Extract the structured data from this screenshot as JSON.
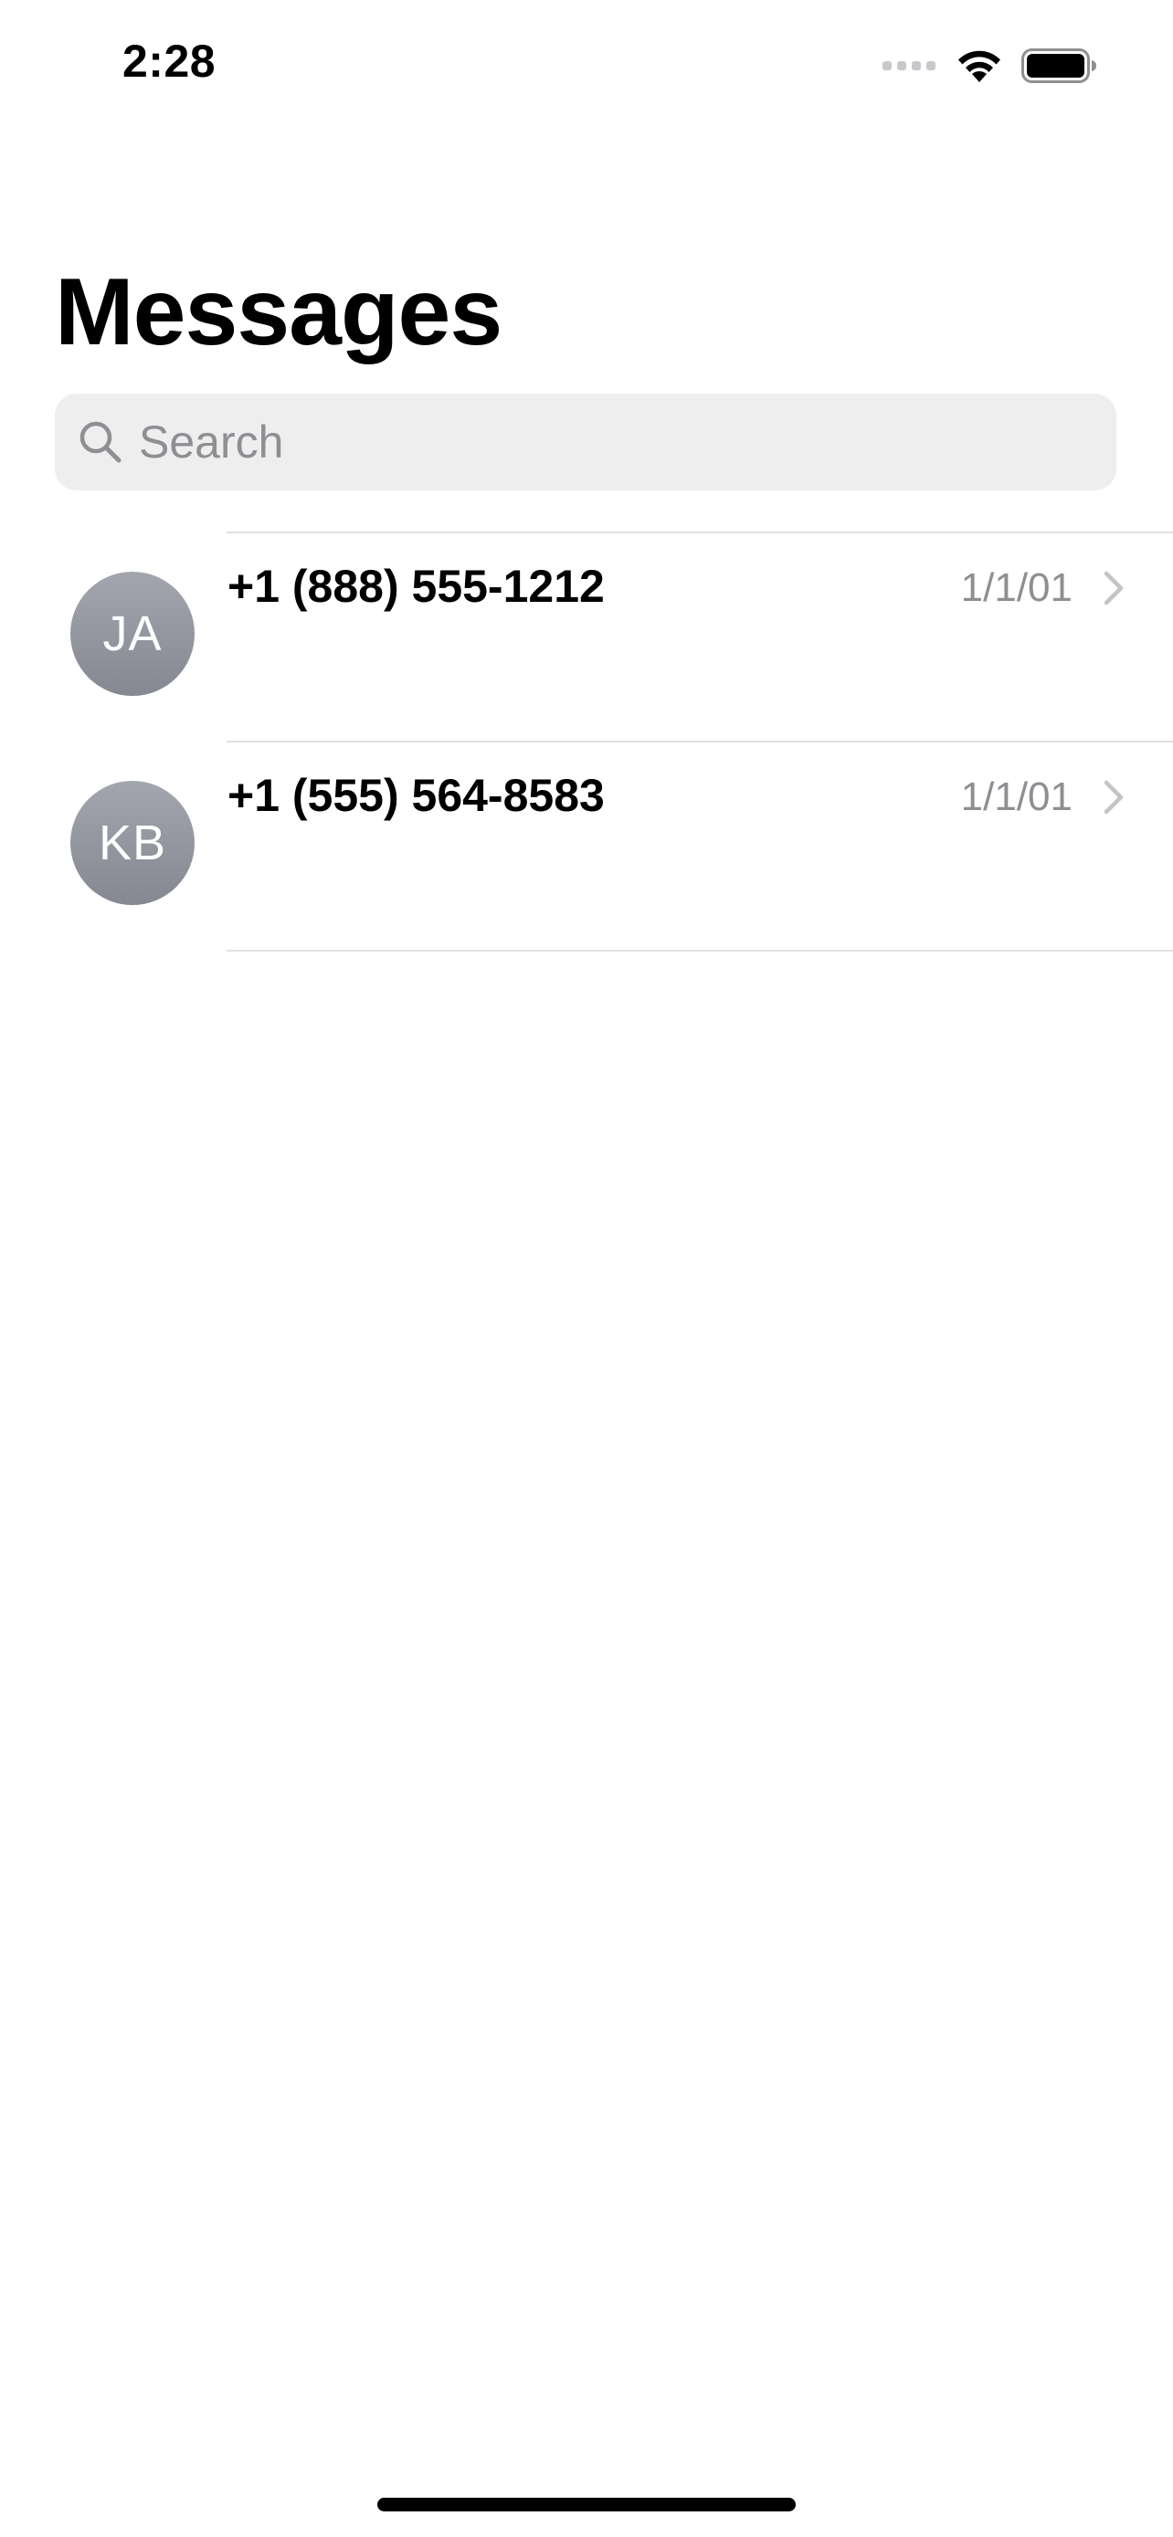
{
  "status_bar": {
    "time": "2:28"
  },
  "page": {
    "title": "Messages"
  },
  "search": {
    "placeholder": "Search",
    "value": ""
  },
  "conversations": [
    {
      "avatar_initials": "JA",
      "name": "+1 (888) 555-1212",
      "date": "1/1/01"
    },
    {
      "avatar_initials": "KB",
      "name": "+1 (555) 564-8583",
      "date": "1/1/01"
    }
  ],
  "colors": {
    "background": "#ffffff",
    "search_background": "#eeeeef",
    "secondary_text": "#8e8e93",
    "avatar": "#999ca4",
    "divider": "#e0e0e3"
  },
  "icons": {
    "signal": "cellular-signal-icon",
    "wifi": "wifi-icon",
    "battery": "battery-icon",
    "search": "search-icon",
    "chevron": "chevron-right-icon"
  }
}
